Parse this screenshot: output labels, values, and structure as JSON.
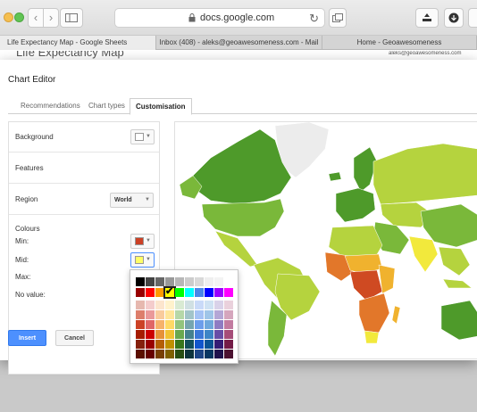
{
  "browser": {
    "url": "docs.google.com",
    "tabs": [
      {
        "label": "Life Expectancy Map - Google Sheets",
        "active": true
      },
      {
        "label": "Inbox (408) - aleks@geoawesomeness.com - Mail",
        "active": false
      },
      {
        "label": "Home - Geoawesomeness",
        "active": false
      }
    ],
    "icons": [
      "back-icon",
      "forward-icon",
      "sidebar-icon",
      "lock-icon",
      "reload-icon",
      "tabs-icon",
      "share-icon",
      "download-icon"
    ]
  },
  "page_behind": {
    "title": "Life Expectancy Map",
    "account": "aleks@geoawesomeness.com"
  },
  "chart_editor": {
    "title": "Chart Editor",
    "tabs": [
      "Recommendations",
      "Chart types",
      "Customisation"
    ],
    "active_tab": "Customisation",
    "sections": {
      "background": {
        "label": "Background",
        "color": "#ffffff"
      },
      "features": {
        "label": "Features"
      },
      "region": {
        "label": "Region",
        "value": "World"
      },
      "colours": {
        "label": "Colours",
        "min_label": "Min:",
        "min_color": "#cc4125",
        "mid_label": "Mid:",
        "mid_color": "#ffff66",
        "max_label": "Max:",
        "no_value_label": "No value:"
      }
    },
    "buttons": {
      "insert": "Insert",
      "cancel": "Cancel"
    },
    "palette": {
      "rows": [
        [
          "#000000",
          "#434343",
          "#666666",
          "#999999",
          "#b7b7b7",
          "#cccccc",
          "#d9d9d9",
          "#efefef",
          "#f3f3f3",
          "#ffffff"
        ],
        [
          "#980000",
          "#ff0000",
          "#ff9900",
          "#ffff00",
          "#00ff00",
          "#00ffff",
          "#4a86e8",
          "#0000ff",
          "#9900ff",
          "#ff00ff"
        ],
        [
          "#e6b8af",
          "#f4cccc",
          "#fce5cd",
          "#fff2cc",
          "#d9ead3",
          "#d0e0e3",
          "#c9daf8",
          "#cfe2f3",
          "#d9d2e9",
          "#ead1dc"
        ],
        [
          "#dd7e6b",
          "#ea9999",
          "#f9cb9c",
          "#ffe599",
          "#b6d7a8",
          "#a2c4c9",
          "#a4c2f4",
          "#9fc5e8",
          "#b4a7d6",
          "#d5a6bd"
        ],
        [
          "#cc4125",
          "#e06666",
          "#f6b26b",
          "#ffd966",
          "#93c47d",
          "#76a5af",
          "#6d9eeb",
          "#6fa8dc",
          "#8e7cc3",
          "#c27ba0"
        ],
        [
          "#a61c00",
          "#cc0000",
          "#e69138",
          "#f1c232",
          "#6aa84f",
          "#45818e",
          "#3c78d8",
          "#3d85c6",
          "#674ea7",
          "#a64d79"
        ],
        [
          "#85200c",
          "#990000",
          "#b45f06",
          "#bf9000",
          "#38761d",
          "#134f5c",
          "#1155cc",
          "#0b5394",
          "#351c75",
          "#741b47"
        ],
        [
          "#5b0f00",
          "#660000",
          "#783f04",
          "#7f6000",
          "#274e13",
          "#0c343d",
          "#1c4587",
          "#073763",
          "#20124d",
          "#4c1130"
        ]
      ],
      "selected": {
        "row": 1,
        "col": 3
      }
    }
  },
  "map_colors": {
    "no_data": "#eeeeee",
    "high": "#4e9a2a",
    "upper": "#7ab83a",
    "mid_high": "#b5d33e",
    "mid": "#f2e93c",
    "mid_low": "#f0b22e",
    "low": "#e2772a",
    "lowest": "#cf4a22"
  }
}
